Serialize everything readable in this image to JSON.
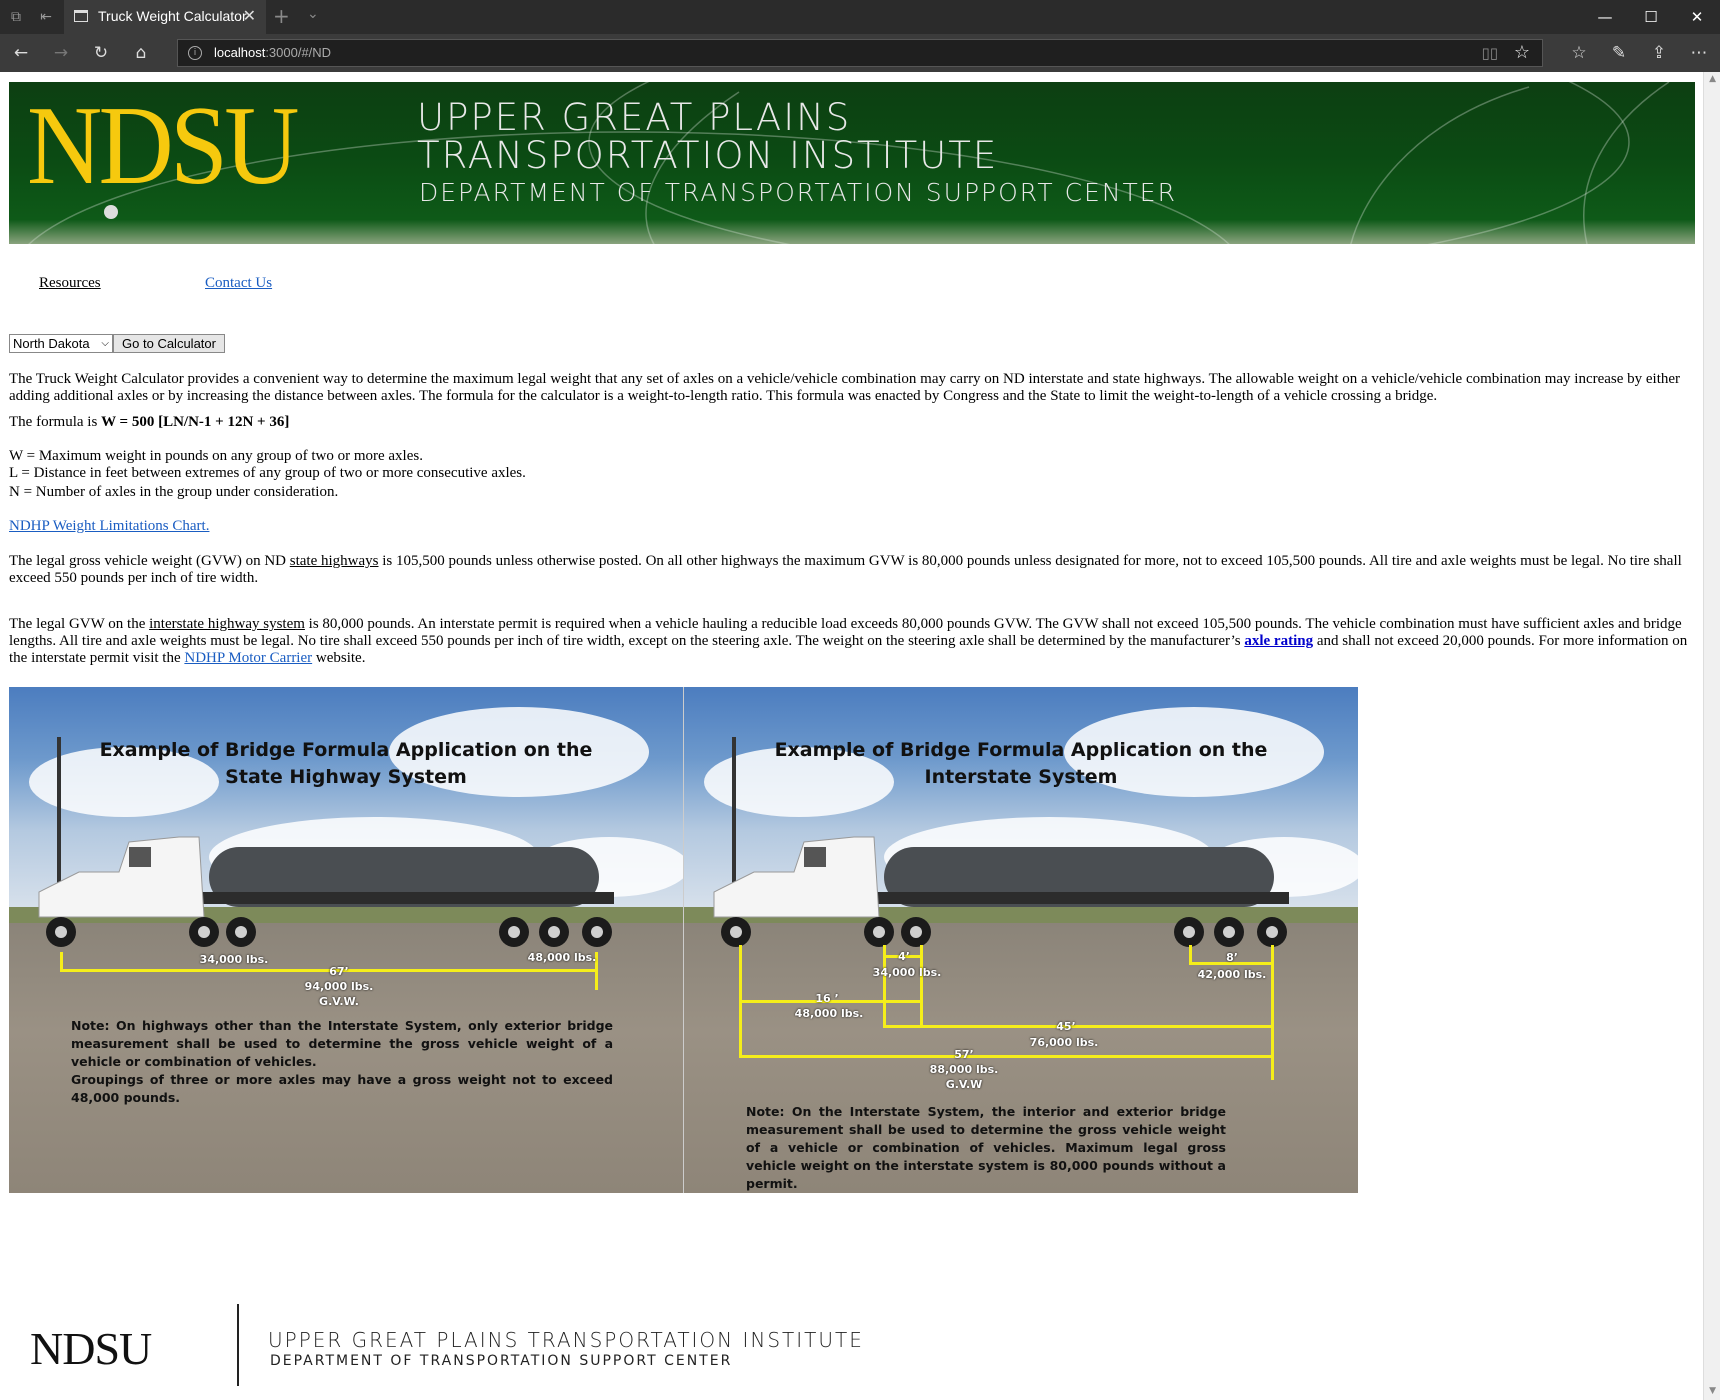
{
  "browser": {
    "tab_title": "Truck Weight Calculator",
    "url_host": "localhost",
    "url_rest": ":3000/#/ND"
  },
  "banner": {
    "logo": "NDSU",
    "line1": "UPPER GREAT PLAINS",
    "line2": "TRANSPORTATION INSTITUTE",
    "line3": "DEPARTMENT OF TRANSPORTATION SUPPORT CENTER",
    "colors": {
      "green": "#0b4a13",
      "gold": "#f6c90e"
    }
  },
  "nav": {
    "resources": "Resources",
    "contact": "Contact Us"
  },
  "calculator": {
    "state_selected": "North Dakota",
    "go_button": "Go to Calculator"
  },
  "content": {
    "intro": "The Truck Weight Calculator provides a convenient way to determine the maximum legal weight that any set of axles on a vehicle/vehicle combination may carry on ND interstate and state highways. The allowable weight on a vehicle/vehicle combination may increase by either adding additional axles or by increasing the distance between axles. The formula for the calculator is a weight-to-length ratio. This formula was enacted by Congress and the State to limit the weight-to-length of a vehicle crossing a bridge.",
    "formula_prefix": "The formula is ",
    "formula": "W = 500 [LN/N-1 + 12N + 36]",
    "def_w": "W = Maximum weight in pounds on any group of two or more axles.",
    "def_l": "L = Distance in feet between extremes of any group of two or more consecutive axles.",
    "def_n": "N = Number of axles in the group under consideration.",
    "chart_link": "NDHP Weight Limitations Chart.",
    "p1_a": "The legal gross vehicle weight (GVW) on ND ",
    "p1_link": "state highways",
    "p1_b": " is 105,500 pounds unless otherwise posted. On all other highways the maximum GVW is 80,000 pounds unless designated for more, not to exceed 105,500 pounds. All tire and axle weights must be legal. No tire shall exceed 550 pounds per inch of tire width.",
    "p2_a": "The legal GVW on the ",
    "p2_link": "interstate highway system",
    "p2_b": " is 80,000 pounds. An interstate permit is required when a vehicle hauling a reducible load exceeds 80,000 pounds GVW. The GVW shall not exceed 105,500 pounds. The vehicle combination must have sufficient axles and bridge lengths. All tire and axle weights must be legal. No tire shall exceed 550 pounds per inch of tire width, except on the steering axle. The weight on the steering axle shall be determined by the manufacturer’s ",
    "p2_link2": "axle rating",
    "p2_c": " and shall not exceed 20,000 pounds. For more information on the interstate permit visit the ",
    "p2_link3": "NDHP Motor Carrier",
    "p2_d": " website."
  },
  "example_left": {
    "title1": "Example of Bridge Formula Application on the",
    "title2": "State Highway System",
    "w_front": "34,000 lbs.",
    "w_rear": "48,000 lbs.",
    "len": "67’",
    "gvw": "94,000 lbs.",
    "gvw_label": "G.V.W.",
    "note1": "Note:  On highways other than the Interstate System, only exterior bridge measurement shall be used to determine the gross vehicle weight of a vehicle  or combination of vehicles.",
    "note2": "Groupings of three or more axles may have a gross weight not to exceed 48,000 pounds."
  },
  "example_right": {
    "title1": "Example of Bridge Formula Application on the",
    "title2": "Interstate System",
    "d1": "4’",
    "w1": "34,000 lbs.",
    "d2": "8’",
    "w2": "42,000 lbs.",
    "d3": "16 ’",
    "w3": "48,000 lbs.",
    "d4": "45’",
    "w4": "76,000 lbs.",
    "d5": "57’",
    "w5": "88,000 lbs.",
    "gvw_label": "G.V.W",
    "note": "Note:  On the  Interstate System, the interior and exterior bridge  measurement shall be used to determine the gross vehicle weight of a vehicle or combination of vehicles.  Maximum  legal gross vehicle weight on the interstate system is 80,000 pounds without a permit."
  },
  "footer": {
    "logo": "NDSU",
    "line1": "UPPER GREAT PLAINS TRANSPORTATION INSTITUTE",
    "line2": "DEPARTMENT OF TRANSPORTATION SUPPORT CENTER"
  }
}
